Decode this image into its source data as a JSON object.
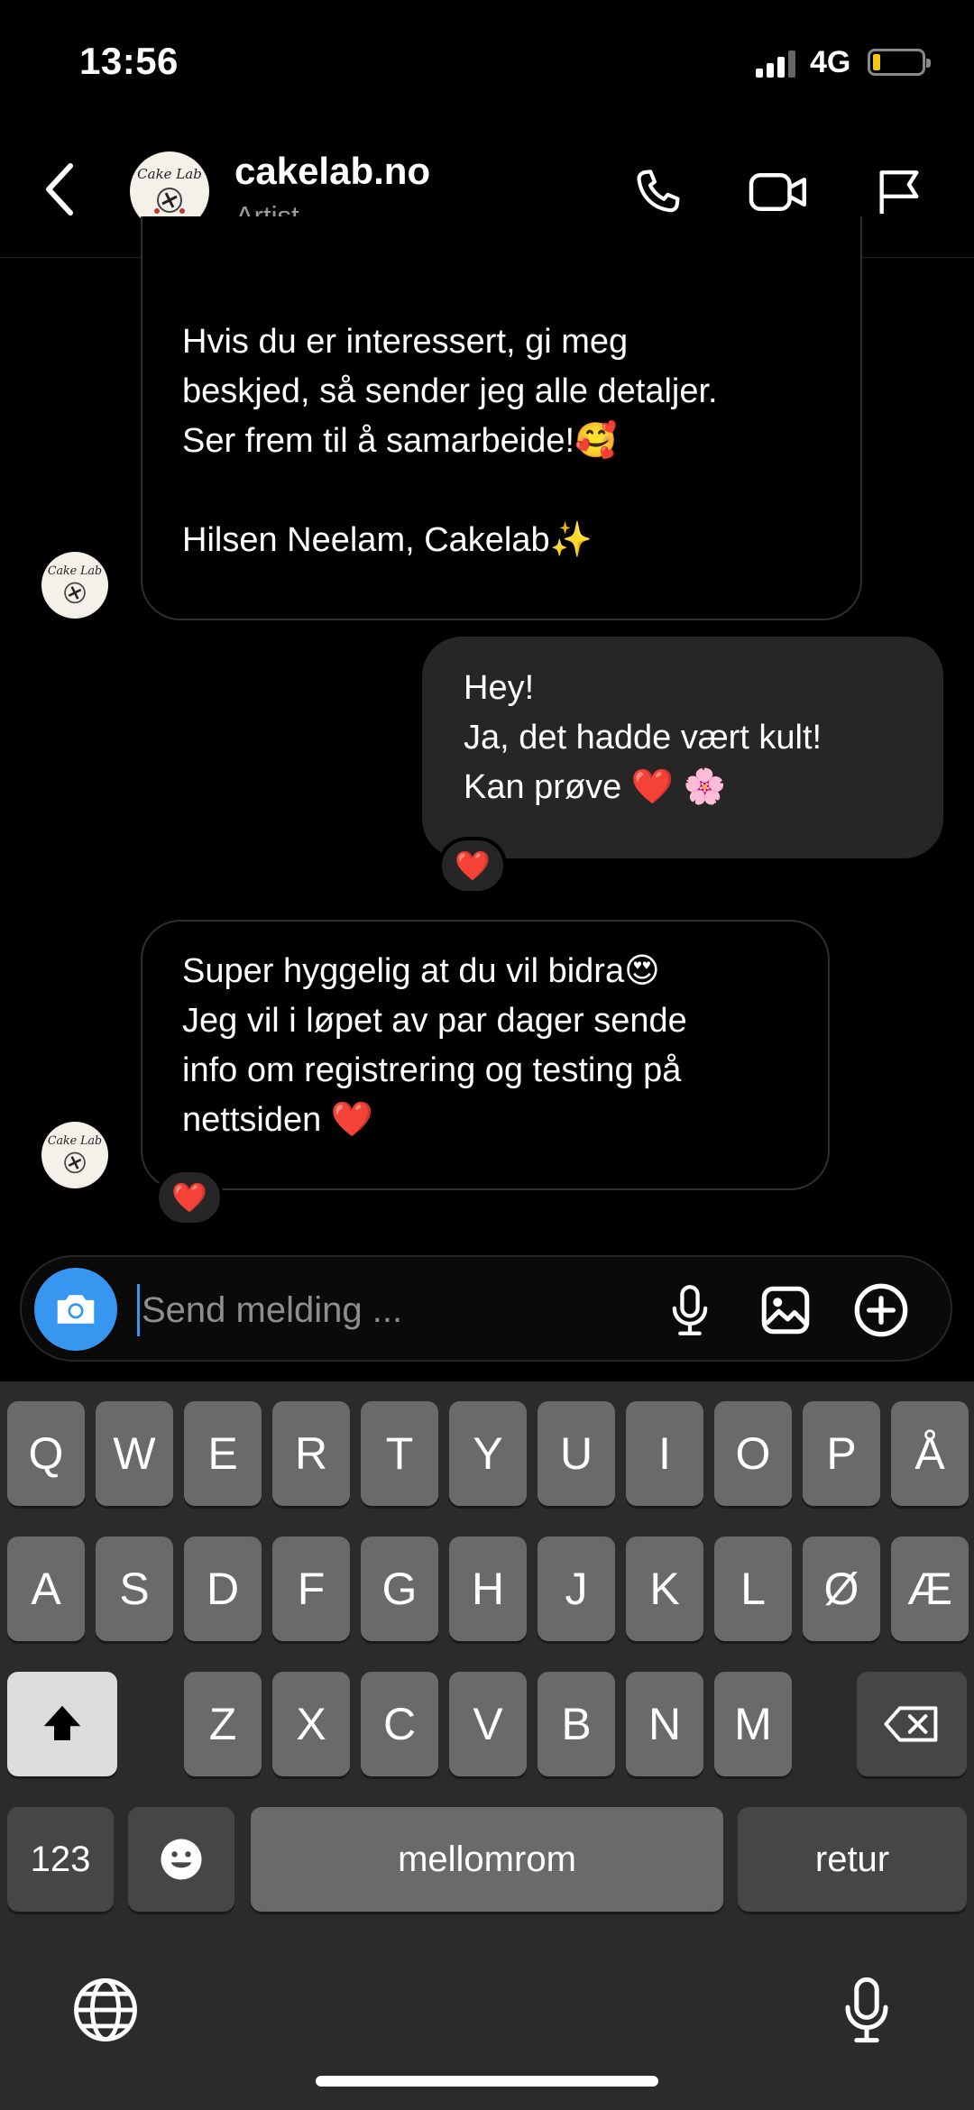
{
  "status_bar": {
    "time": "13:56",
    "network": "4G"
  },
  "header": {
    "name": "cakelab.no",
    "subtitle": "Artist"
  },
  "messages": [
    {
      "sender": "cakelab.no",
      "text": "Hvis du er interessert, gi meg\nbeskjed, så sender jeg alle detaljer.\nSer frem til å samarbeide!🥰\n\nHilsen Neelam, Cakelab✨"
    },
    {
      "sender": "me",
      "text": "Hey!\nJa, det hadde vært kult!\nKan prøve ❤️ 🌸",
      "reaction": "❤️"
    },
    {
      "sender": "cakelab.no",
      "text": "Super hyggelig at du vil bidra😍\nJeg vil i løpet av par dager sende\ninfo om registrering og testing på\nnettsiden ❤️",
      "reaction": "❤️"
    }
  ],
  "composer": {
    "placeholder": "Send melding ..."
  },
  "keyboard": {
    "row1": [
      "Q",
      "W",
      "E",
      "R",
      "T",
      "Y",
      "U",
      "I",
      "O",
      "P",
      "Å"
    ],
    "row2": [
      "A",
      "S",
      "D",
      "F",
      "G",
      "H",
      "J",
      "K",
      "L",
      "Ø",
      "Æ"
    ],
    "row3": [
      "Z",
      "X",
      "C",
      "V",
      "B",
      "N",
      "M"
    ],
    "numbers_key": "123",
    "space_key": "mellomrom",
    "return_key": "retur"
  },
  "icons": [
    "back-icon",
    "phone-icon",
    "video-icon",
    "flag-icon",
    "camera-icon",
    "microphone-icon",
    "gallery-icon",
    "plus-icon",
    "shift-icon",
    "backspace-icon",
    "emoji-icon",
    "globe-icon",
    "dictation-icon"
  ]
}
